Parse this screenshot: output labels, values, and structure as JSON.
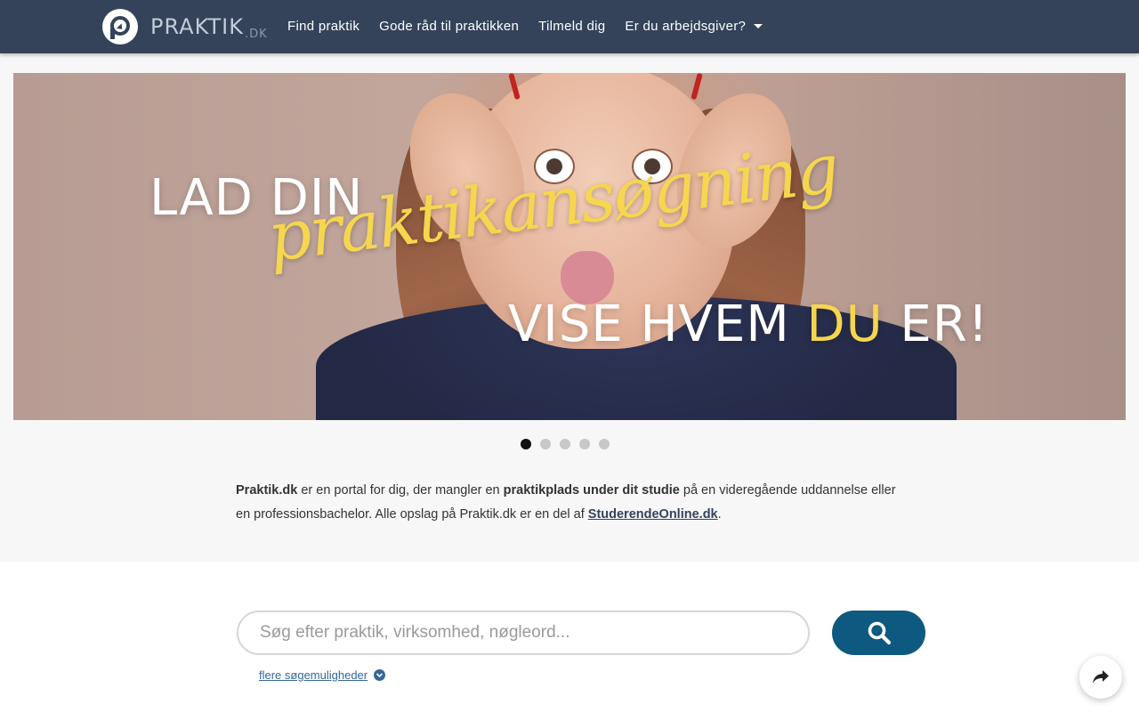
{
  "brand": {
    "name": "PRAKTIK",
    "suffix": ".DK"
  },
  "nav": {
    "items": [
      {
        "label": "Find praktik"
      },
      {
        "label": "Gode råd til praktikken"
      },
      {
        "label": "Tilmeld dig"
      },
      {
        "label": "Er du arbejdsgiver?"
      }
    ]
  },
  "hero": {
    "line1": "LAD DIN",
    "script": "praktikansøgning",
    "line3_pre": "VISE HVEM ",
    "line3_highlight": "DU",
    "line3_post": " ER!"
  },
  "carousel": {
    "slide_count": 5,
    "active_index": 0
  },
  "intro": {
    "p1_bold": "Praktik.dk",
    "p1_text1": " er en portal for dig, der mangler en ",
    "p1_bold2": "praktikplads under dit studie",
    "p1_text2": " på en videregående uddannelse eller en professionsbachelor. Alle opslag på Praktik.dk er en del af ",
    "link": "StuderendeOnline.dk",
    "p1_end": "."
  },
  "search": {
    "placeholder": "Søg efter praktik, virksomhed, nøgleord...",
    "more_label": "flere søgemuligheder"
  },
  "colors": {
    "navbar": "#34435a",
    "accent_yellow": "#f6d64e",
    "search_button": "#0e5980",
    "link": "#34679a"
  },
  "icons": {
    "search": "search-icon",
    "share": "share-icon",
    "chevron": "chevron-down-icon",
    "caret": "caret-down-icon"
  }
}
